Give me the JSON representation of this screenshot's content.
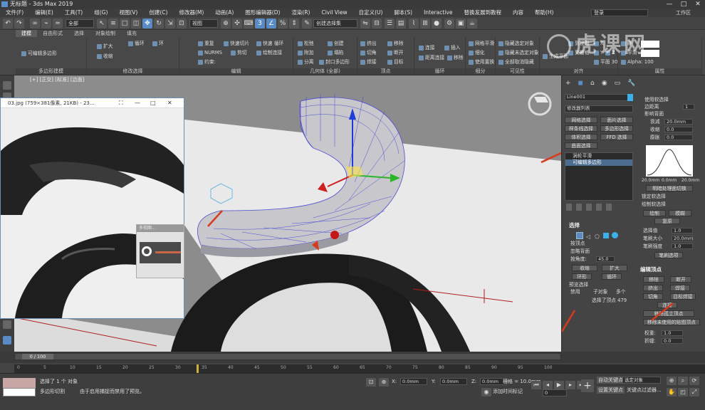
{
  "window": {
    "title": "无标题 - 3ds Max 2019",
    "controls": [
      "—",
      "□",
      "✕"
    ]
  },
  "menu": {
    "items": [
      "文件(F)",
      "编辑(E)",
      "工具(T)",
      "组(G)",
      "视图(V)",
      "创建(C)",
      "修改器(M)",
      "动画(A)",
      "图形编辑器(D)",
      "渲染(R)",
      "Civil View",
      "自定义(U)",
      "脚本(S)",
      "Interactive",
      "替换发展到教程",
      "内容",
      "帮助(H)"
    ],
    "login": "登录",
    "workspace": "工作区"
  },
  "toolbar": {
    "filter_value": "全部",
    "view_value": "视图",
    "selection_set_value": "创建选择集"
  },
  "ribbon": {
    "tabs": [
      "建模",
      "自由形式",
      "选择",
      "对象绘制",
      "填充"
    ],
    "active_tab": "建模",
    "groups": {
      "polygon_modeling": {
        "caption": "多边形建模",
        "items": [
          "可编辑多边形"
        ]
      },
      "modify_selection": {
        "caption": "修改选择",
        "items": [
          "扩大",
          "收缩",
          "循环",
          "环"
        ]
      },
      "edit": {
        "caption": "编辑",
        "items": [
          "重复",
          "快速切片",
          "快速 循环",
          "NURMS",
          "剪切",
          "绘制连接",
          "约束:"
        ]
      },
      "geometry": {
        "caption": "几何体 (全部)",
        "items": [
          "松弛",
          "创建",
          "附加",
          "塌陷",
          "分离",
          "封口多边形"
        ]
      },
      "vertices": {
        "caption": "顶点",
        "items": [
          "挤出",
          "移除",
          "切角",
          "断开",
          "焊接",
          "目标"
        ]
      },
      "loops": {
        "caption": "循环",
        "items": [
          "连接",
          "插入",
          "距离连接",
          "移除"
        ]
      },
      "subdivision": {
        "caption": "细分",
        "items": [
          "网格平滑",
          "细化",
          "使用置换"
        ]
      },
      "visibility": {
        "caption": "可见性",
        "items": [
          "隐藏选定对象",
          "隐藏未选定对象",
          "全部取消隐藏"
        ]
      },
      "align": {
        "caption": "对齐",
        "items": [
          "生成平面",
          "到视图",
          "到栅格",
          "X",
          "Y",
          "Z",
          "平面 30"
        ]
      },
      "properties": {
        "caption": "属性",
        "items": [
          "硬",
          "平滑",
          "Alpha: 100"
        ]
      }
    }
  },
  "viewport": {
    "label": "[+] [正交] [标准] [边面]"
  },
  "image_window": {
    "title": "03.jpg (759×381像素, 21KB) - 23...",
    "controls": [
      "⛶",
      "—",
      "□",
      "✕"
    ],
    "subwindow_title": "多视图..."
  },
  "command_panel": {
    "object_name": "Line001",
    "modifier_list_label": "修改器列表",
    "modifier_buttons": [
      "网格选择",
      "面片选择",
      "样条线选择",
      "多边形选择",
      "体积选择",
      "FFD 选择",
      "曲面选择"
    ],
    "stack": [
      "涡轮平滑",
      "可编辑多边形"
    ],
    "soft_selection": {
      "title": "使用软选择",
      "edge_distance": "边距离",
      "edge_distance_value": "1",
      "affect_backfacing": "影响背面",
      "falloff_label": "衰减",
      "falloff_value": "20.0mm",
      "pinch_label": "收缩",
      "pinch_value": "0.0",
      "bubble_label": "膨胀",
      "bubble_value": "0.0",
      "curve_labels": [
        "20.0mm",
        "0.0mm",
        "20.0mm"
      ],
      "shaded_face_toggle": "明暗处理面切换",
      "lock_soft": "锁定软选择",
      "paint_soft": "绘制软选择",
      "paint": "绘制",
      "blur": "模糊",
      "revert": "复原",
      "selection_value_label": "选择值",
      "selection_value": "1.0",
      "brush_size_label": "笔刷大小",
      "brush_size": "20.0mm",
      "brush_strength_label": "笔刷强度",
      "brush_strength": "1.0",
      "brush_options": "笔刷选项"
    },
    "selection": {
      "title": "选择",
      "by_vertex": "按顶点",
      "ignore_backfacing": "忽略背面",
      "by_angle": "按角度:",
      "by_angle_value": "45.0",
      "shrink": "收缩",
      "grow": "扩大",
      "ring": "环形",
      "loop": "循环",
      "preview_selection": "预览选择",
      "preview_options": [
        "禁用",
        "子对象",
        "多个"
      ],
      "selected_count": "选择了顶点 479"
    },
    "edit_vertices": {
      "title": "编辑顶点",
      "remove": "移除",
      "break": "断开",
      "extrude": "挤出",
      "weld": "焊接",
      "chamfer": "切角",
      "target_weld": "目标焊接",
      "connect": "连接",
      "remove_isolated": "移除孤立顶点",
      "remove_unused_map": "移除未使用的贴图顶点",
      "weight_label": "权重:",
      "weight_value": "1.0",
      "crease_label": "折缝:",
      "crease_value": "0.0"
    }
  },
  "timeline": {
    "frame_label": "0 / 100",
    "ticks": [
      "0",
      "5",
      "10",
      "15",
      "20",
      "25",
      "30",
      "35",
      "40",
      "45",
      "50",
      "55",
      "60",
      "65",
      "70",
      "75",
      "80",
      "85",
      "90",
      "95",
      "100"
    ]
  },
  "status": {
    "selected": "选择了 1 个 对象",
    "tool": "多边形切割",
    "hint": "由于启用捕捉而禁用了预览。",
    "x_label": "X:",
    "x_value": "0.0mm",
    "y_label": "Y:",
    "y_value": "0.0mm",
    "z_label": "Z:",
    "z_value": "0.0mm",
    "grid": "栅格 = 10.0mm",
    "add_time_tag": "添加时间标记",
    "auto_key": "自动关键点",
    "set_key": "设置关键点",
    "selected_object": "选定对象",
    "key_filters": "关键点过滤器...",
    "frame_value": "0"
  },
  "watermark": "虎课网",
  "colors": {
    "accent": "#5a8bc4",
    "arrow": "#d63a1f",
    "gizmo_z": "#1f3cd6",
    "gizmo_y": "#2ab52a",
    "gizmo_x": "#d01f1f"
  }
}
